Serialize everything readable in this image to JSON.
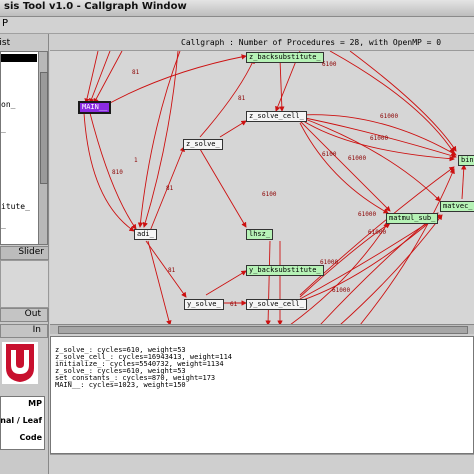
{
  "window": {
    "title": "sis Tool v1.0 - Callgraph Window",
    "menu": "P"
  },
  "left_panel": {
    "list_header": "e List",
    "list_items": [
      "on_",
      "_",
      "itute_",
      "_"
    ],
    "slider_label": "Slider",
    "out_label": "Out",
    "in_label": "In",
    "logo_text": "UH",
    "legend": [
      "MP",
      "rnal / Leaf",
      "Code"
    ]
  },
  "graph": {
    "header": "Callgraph : Number of Procedures = 28, with OpenMP = 0",
    "nodes": {
      "main": "MAIN__",
      "z_backsub": "z_backsubstitute_",
      "z_solve_cell": "z_solve_cell_",
      "z_solve": "z_solve_",
      "adi": "adi_",
      "lhsz": "lhsz_",
      "y_backsub": "y_backsubstitute_",
      "y_solve": "y_solve_",
      "y_solve_cell": "y_solve_cell_",
      "matmul_sub": "matmul_sub_",
      "matvec": "matvec_",
      "bin": "bin"
    },
    "edge_labels": {
      "l6100": "6100",
      "l6100b": "6100",
      "l6100c": "6100",
      "l81a": "81",
      "l81b": "81",
      "l81c": "81",
      "l81d": "81",
      "l61000a": "61000",
      "l61000b": "61000",
      "l61000c": "61000",
      "l61000d": "61000",
      "l61000e": "61000",
      "l61000f": "61000",
      "l61000g": "61000",
      "l1": "1",
      "l810": "810",
      "l61": "61"
    }
  },
  "output_lines": [
    "z_solve_: cycles=610, weight=53",
    "z_solve_cell_: cycles=16943413, weight=114",
    "initialize_: cycles=5540732, weight=1134",
    "z_solve_: cycles=610, weight=53",
    "set_constants_: cycles=870, weight=173",
    "MAIN__: cycles=1023, weight=150"
  ],
  "colors": {
    "edge": "#cc1111",
    "node_green": "#b6f2b6",
    "node_main": "#8a2be2",
    "logo": "#c8102e"
  }
}
